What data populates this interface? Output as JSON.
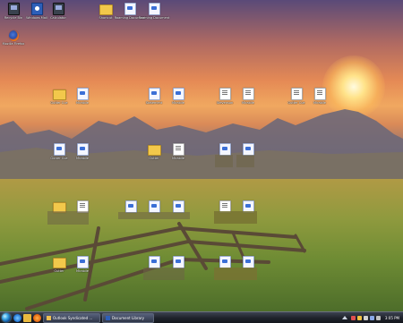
{
  "desktop": {
    "top_icons": [
      {
        "label": "Recycle Bin",
        "kind": "app"
      },
      {
        "label": "Windows Mail",
        "kind": "blue"
      },
      {
        "label": "Calculator",
        "kind": "app"
      },
      {
        "label": "Shortcut",
        "kind": "folder"
      },
      {
        "label": "Roaming Document",
        "kind": "doc"
      },
      {
        "label": "Roaming Document",
        "kind": "doc"
      },
      {
        "label": "Mozilla Firefox",
        "kind": "ff"
      }
    ],
    "grid_icons": [
      {
        "label": "Gutter Cue",
        "kind": "folder"
      },
      {
        "label": "Mirabile",
        "kind": "doc"
      },
      {
        "label": "Statement",
        "kind": "doc"
      },
      {
        "label": "Mirabile",
        "kind": "doc"
      },
      {
        "label": "Stevenson",
        "kind": "white"
      },
      {
        "label": "Mirabile",
        "kind": "white"
      },
      {
        "label": "Gutter Cue",
        "kind": "white"
      },
      {
        "label": "Mirabile",
        "kind": "white"
      },
      {
        "label": "Gutter Cue",
        "kind": "doc"
      },
      {
        "label": "Mirabile",
        "kind": "doc"
      },
      {
        "label": "Gutter",
        "kind": "folder"
      },
      {
        "label": "Mirabile",
        "kind": "white"
      },
      {
        "label": "",
        "kind": "doc"
      },
      {
        "label": "",
        "kind": "doc"
      },
      {
        "label": "",
        "kind": "folder"
      },
      {
        "label": "",
        "kind": "white"
      },
      {
        "label": "",
        "kind": "doc"
      },
      {
        "label": "",
        "kind": "doc"
      },
      {
        "label": "",
        "kind": "doc"
      },
      {
        "label": "",
        "kind": "white"
      },
      {
        "label": "",
        "kind": "doc"
      },
      {
        "label": "Gutter",
        "kind": "folder"
      },
      {
        "label": "Mirabile",
        "kind": "doc"
      },
      {
        "label": "",
        "kind": "doc"
      },
      {
        "label": "",
        "kind": "doc"
      },
      {
        "label": "",
        "kind": "doc"
      },
      {
        "label": "",
        "kind": "doc"
      }
    ]
  },
  "taskbar": {
    "buttons": [
      {
        "label": "Outlook Syndicated ..."
      },
      {
        "label": "Document Library"
      }
    ],
    "clock": "3:05 PM"
  },
  "colors": {
    "sky_top": "#5a4a78",
    "sunset": "#e58a55",
    "field": "#8f9a3e",
    "taskbar": "#1e222a"
  }
}
